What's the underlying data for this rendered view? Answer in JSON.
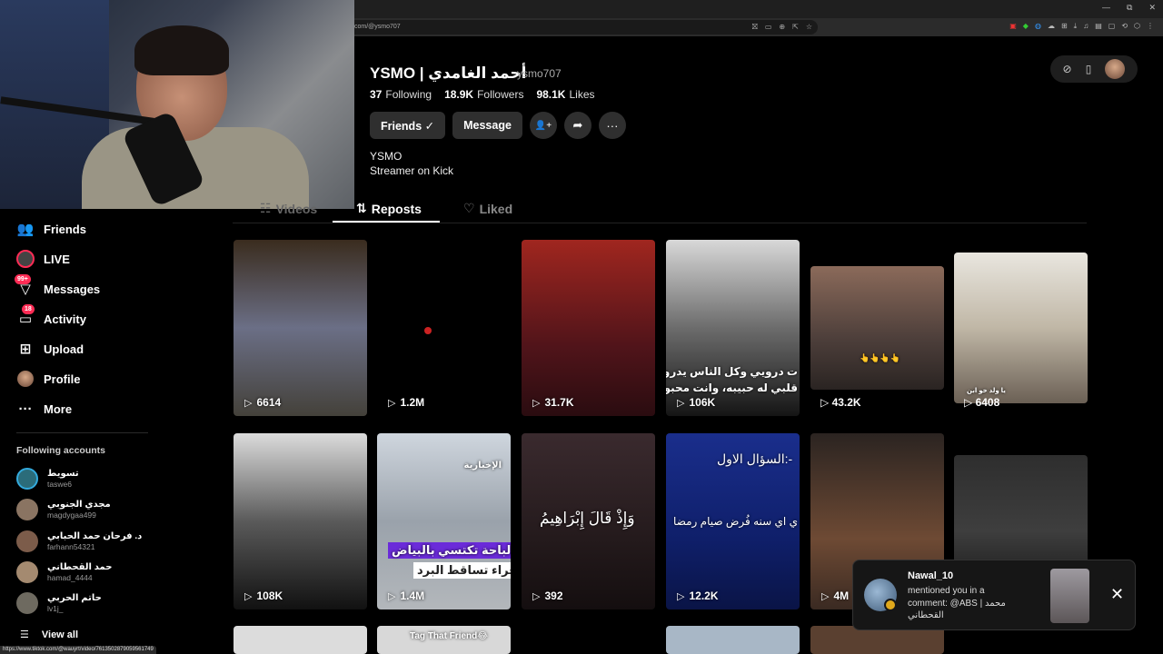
{
  "browser": {
    "url": "com/@ysmo707",
    "window_controls": [
      "—",
      "⧉",
      "✕"
    ],
    "field_icons": [
      "⛝",
      "▭",
      "⊕",
      "⇱",
      "☆"
    ],
    "extensions": [
      "▣",
      "◆",
      "◍",
      "☁",
      "⊞",
      "⤓",
      "♫",
      "▤",
      "▢",
      "⟲",
      "⬡",
      "⋮"
    ],
    "status_url": "https://www.tiktok.com/@wauyrt/video/7613502879059561749"
  },
  "sidebar": {
    "nav": [
      {
        "label": "Friends",
        "icon": "friends-icon",
        "glyph": "👥"
      },
      {
        "label": "LIVE",
        "icon": "live-icon",
        "glyph": ""
      },
      {
        "label": "Messages",
        "icon": "messages-icon",
        "glyph": "▽",
        "badge": "99+"
      },
      {
        "label": "Activity",
        "icon": "activity-icon",
        "glyph": "▭",
        "badge": "18"
      },
      {
        "label": "Upload",
        "icon": "upload-icon",
        "glyph": "⊞"
      },
      {
        "label": "Profile",
        "icon": "profile-icon",
        "glyph": ""
      },
      {
        "label": "More",
        "icon": "more-icon",
        "glyph": "···"
      }
    ],
    "following_title": "Following accounts",
    "following": [
      {
        "name": "تسويط",
        "handle": "taswe6",
        "color": "#2b6c7a"
      },
      {
        "name": "مجدي الجنوبي",
        "handle": "magdygaa499",
        "color": "#8a7462"
      },
      {
        "name": "د. فرحان حمد الحبابي",
        "handle": "farhann54321",
        "color": "#7c5c4a"
      },
      {
        "name": "حمد القحطاني",
        "handle": "hamad_4444",
        "color": "#a48a70"
      },
      {
        "name": "حاتم الحربي",
        "handle": "lv1j_",
        "color": "#6e6a60"
      }
    ],
    "view_all": "View all",
    "view_all_glyph": "☰"
  },
  "profile": {
    "name": "YSMO | أحمد الغامدي",
    "handle": "ysmo707",
    "following_count": "37",
    "following_label": "Following",
    "followers_count": "18.9K",
    "followers_label": "Followers",
    "likes_count": "98.1K",
    "likes_label": "Likes",
    "friends_button": "Friends ✓",
    "message_button": "Message",
    "add_friend_glyph": "👤+",
    "share_glyph": "➦",
    "more_glyph": "···",
    "bio_line1": "YSMO",
    "bio_line2": "Streamer on Kick"
  },
  "topright": {
    "compass_glyph": "⊘",
    "device_glyph": "▯"
  },
  "tabs": {
    "videos": "Videos",
    "videos_glyph": "☷",
    "reposts": "Reposts",
    "reposts_glyph": "⇅",
    "liked": "Liked",
    "liked_glyph": "♡"
  },
  "grid": {
    "row1": [
      {
        "views": "6614",
        "bg": "linear-gradient(180deg,#3a2c1e,#6b6f86 50%,#44413a)"
      },
      {
        "views": "1.2M",
        "bg": "#000"
      },
      {
        "views": "31.7K",
        "bg": "linear-gradient(180deg,#a0261f,#51141a 60%,#2a0c10)"
      },
      {
        "views": "106K",
        "bg": "linear-gradient(180deg,#d8d8d8,#6c6c6c 50%,#151515)"
      },
      {
        "views": "43.2K",
        "bg": "linear-gradient(180deg,#8b6a5a,#4c3e3a 60%,#2a2422)"
      },
      {
        "views": "6408",
        "bg": "linear-gradient(180deg,#e9e6df,#c0b7a6 50%,#6b6055)"
      }
    ],
    "row2": [
      {
        "views": "108K",
        "bg": "linear-gradient(180deg,#dcdcdc,#5a5a5a 50%,#111)"
      },
      {
        "views": "1.4M",
        "bg": "linear-gradient(180deg,#cfd6de,#9aa2ab 50%,#b3b7bb)"
      },
      {
        "views": "392",
        "bg": "linear-gradient(180deg,#3a2a2e,#241a1c 60%,#140e0f)"
      },
      {
        "views": "12.2K",
        "bg": "linear-gradient(180deg,#1a2e8c,#0f1f6a 60%,#0a1446)"
      },
      {
        "views": "4M",
        "bg": "linear-gradient(180deg,#2b2421,#6e4a34 60%,#3a2a22)"
      },
      {
        "views": "",
        "bg": "linear-gradient(180deg,#2e2e2e,#3e3e3e 60%,#1e1e1e)"
      }
    ],
    "captions": {
      "c4_line1": "ت درويي وكل الناس يدروا بي",
      "c4_line2": "قلبي له حبيبه، وانت محبوبي",
      "c5": "👆👆👆👆",
      "c6": "يا ولد خو ابن",
      "r2c2_tag": "الإخبارية",
      "r2c2_line1": "الباحة تكتسي بالبياض",
      "r2c2_line2": "جراء تساقط البرد",
      "r2c3": "وَإِذْ قَالَ إِبْرَاهِيمُ",
      "r2c4_title": "السؤال الاول:-",
      "r2c4_body": "ي اي سنه فُرض صيام رمضا",
      "r3c2": "Tag That Friend😂"
    }
  },
  "notification": {
    "user": "Nawal_10",
    "message": "mentioned you in a comment: @ABS | محمد القحطاني",
    "close_glyph": "✕"
  }
}
